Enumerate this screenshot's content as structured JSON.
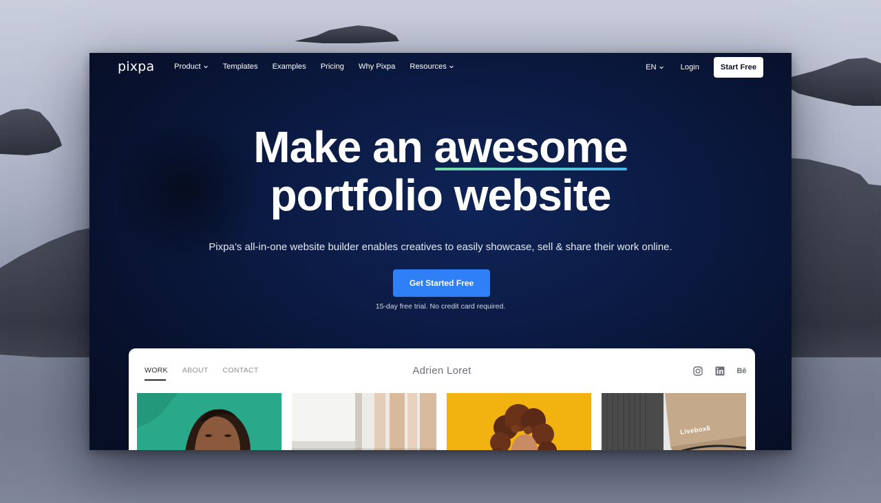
{
  "nav": {
    "logo": "pixpa",
    "links": [
      {
        "label": "Product",
        "dropdown": true
      },
      {
        "label": "Templates",
        "dropdown": false
      },
      {
        "label": "Examples",
        "dropdown": false
      },
      {
        "label": "Pricing",
        "dropdown": false
      },
      {
        "label": "Why Pixpa",
        "dropdown": false
      },
      {
        "label": "Resources",
        "dropdown": true
      }
    ],
    "language": "EN",
    "login": "Login",
    "start_free": "Start Free"
  },
  "hero": {
    "title_prefix": "Make an ",
    "title_highlight": "awesome",
    "title_line2": "portfolio website",
    "subtitle": "Pixpa’s all-in-one website builder enables creatives to easily showcase, sell & share their work online.",
    "cta": "Get Started Free",
    "trial_note": "15-day free trial. No credit card required."
  },
  "preview": {
    "tabs": [
      "WORK",
      "ABOUT",
      "CONTACT"
    ],
    "active_tab": "WORK",
    "name": "Adrien Loret",
    "social_icons": [
      "instagram-icon",
      "linkedin-icon",
      "behance-icon"
    ],
    "behance_text": "Bē",
    "tile_label": "Livebox6"
  },
  "colors": {
    "cta_blue": "#2f7ff7",
    "hero_bg": "#0b1a42",
    "highlight_gradient_start": "#7be0a6",
    "highlight_gradient_end": "#47b6ee",
    "tile_teal": "#2aa98a",
    "tile_yellow": "#f2b310"
  }
}
